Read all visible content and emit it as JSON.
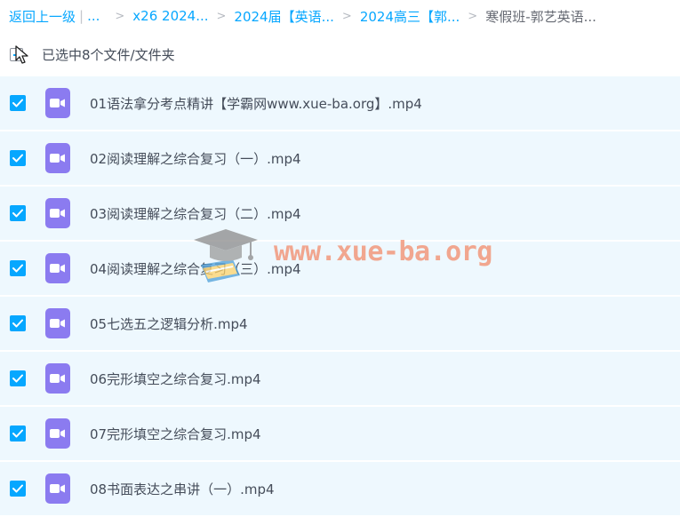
{
  "breadcrumb": {
    "back": "返回上一级",
    "sep": "|",
    "ellipsis": "...",
    "crumbs": [
      "x26 2024...",
      "2024届【英语...",
      "2024高三【郭..."
    ],
    "current": "寒假班-郭艺英语..."
  },
  "selection": {
    "text": "已选中8个文件/文件夹"
  },
  "files": [
    "01语法拿分考点精讲【学霸网www.xue-ba.org】.mp4",
    "02阅读理解之综合复习（一）.mp4",
    "03阅读理解之综合复习（二）.mp4",
    "04阅读理解之综合复习（三）.mp4",
    "05七选五之逻辑分析.mp4",
    "06完形填空之综合复习.mp4",
    "07完形填空之综合复习.mp4",
    "08书面表达之串讲（一）.mp4"
  ],
  "watermark": {
    "text": "www.xue-ba.org"
  },
  "colors": {
    "accent": "#06a7ff",
    "row_bg": "#eef8fe",
    "video_icon": "#8b7bf0"
  }
}
